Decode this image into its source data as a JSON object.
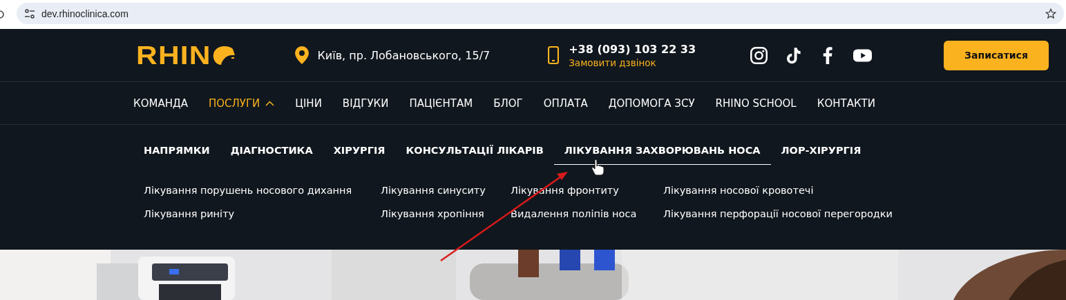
{
  "browser": {
    "url": "dev.rhinoclinica.com"
  },
  "header": {
    "logo": "RHIN",
    "address": "Київ, пр. Лобановського, 15/7",
    "phone": "+38 (093) 103 22 33",
    "callback": "Замовити дзвінок",
    "cta": "Записатися"
  },
  "nav": [
    {
      "label": "КОМАНДА",
      "selected": false,
      "expanded": false
    },
    {
      "label": "ПОСЛУГИ",
      "selected": true,
      "expanded": true
    },
    {
      "label": "ЦІНИ",
      "selected": false,
      "expanded": false
    },
    {
      "label": "ВІДГУКИ",
      "selected": false,
      "expanded": false
    },
    {
      "label": "ПАЦІЄНТАМ",
      "selected": false,
      "expanded": false
    },
    {
      "label": "БЛОГ",
      "selected": false,
      "expanded": false
    },
    {
      "label": "ОПЛАТА",
      "selected": false,
      "expanded": false
    },
    {
      "label": "ДОПОМОГА ЗСУ",
      "selected": false,
      "expanded": false
    },
    {
      "label": "RHINO SCHOOL",
      "selected": false,
      "expanded": false
    },
    {
      "label": "КОНТАКТИ",
      "selected": false,
      "expanded": false
    }
  ],
  "submenu_tabs": [
    {
      "label": "НАПРЯМКИ",
      "selected": false
    },
    {
      "label": "ДІАГНОСТИКА",
      "selected": false
    },
    {
      "label": "ХІРУРГІЯ",
      "selected": false
    },
    {
      "label": "КОНСУЛЬТАЦІЇ ЛІКАРІВ",
      "selected": false
    },
    {
      "label": "ЛІКУВАННЯ ЗАХВОРЮВАНЬ НОСА",
      "selected": true
    },
    {
      "label": "ЛОР-ХІРУРГІЯ",
      "selected": false
    }
  ],
  "submenu_links": [
    [
      "Лікування порушень носового дихання",
      "Лікування риніту"
    ],
    [
      "Лікування синуситу",
      "Лікування хропіння"
    ],
    [
      "Лікування фронтиту",
      "Видалення поліпів носа"
    ],
    [
      "Лікування носової кровотечі",
      "Лікування перфорації носової перегородки"
    ]
  ]
}
